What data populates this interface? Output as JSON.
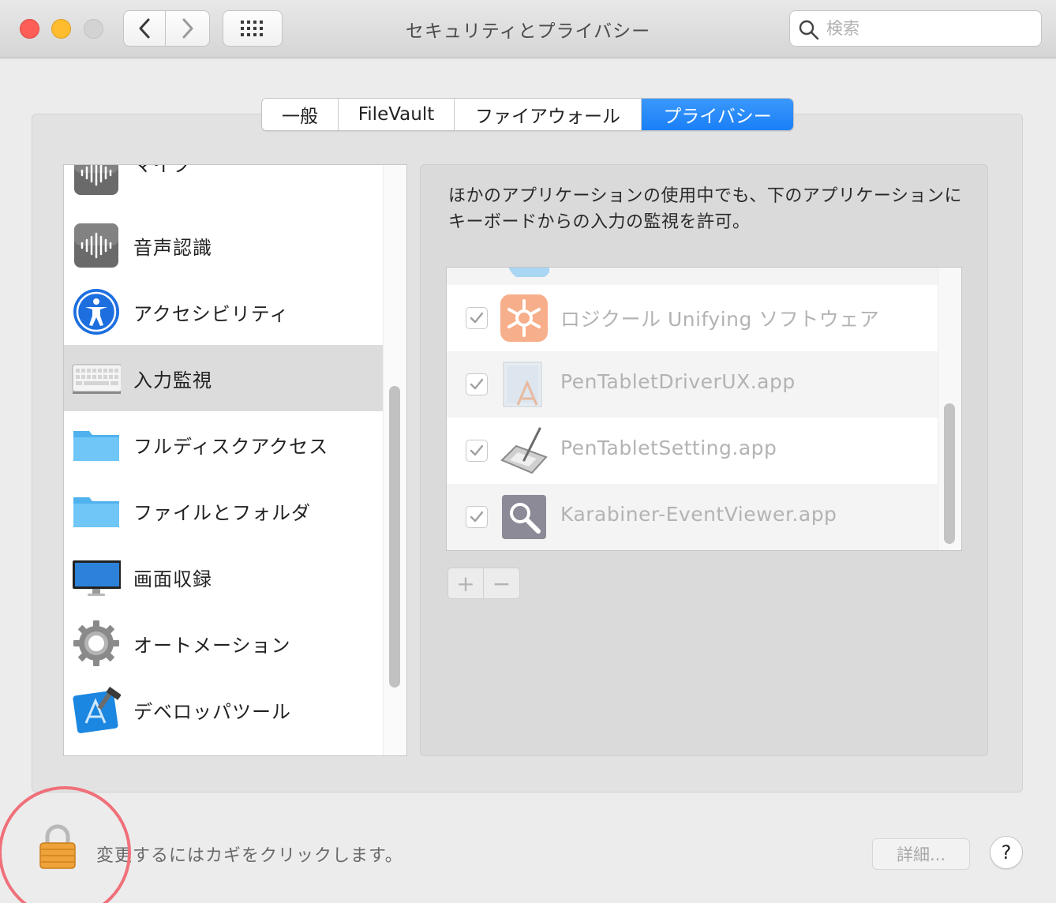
{
  "window": {
    "title": "セキュリティとプライバシー",
    "search_placeholder": "検索"
  },
  "tabs": [
    {
      "label": "一般"
    },
    {
      "label": "FileVault"
    },
    {
      "label": "ファイアウォール"
    },
    {
      "label": "プライバシー",
      "selected": true
    }
  ],
  "categories": [
    {
      "label": "マイク",
      "icon": "microphone-icon"
    },
    {
      "label": "音声認識",
      "icon": "speech-recognition-icon"
    },
    {
      "label": "アクセシビリティ",
      "icon": "accessibility-icon"
    },
    {
      "label": "入力監視",
      "icon": "keyboard-icon",
      "selected": true
    },
    {
      "label": "フルディスクアクセス",
      "icon": "folder-icon"
    },
    {
      "label": "ファイルとフォルダ",
      "icon": "folder-icon"
    },
    {
      "label": "画面収録",
      "icon": "display-icon"
    },
    {
      "label": "オートメーション",
      "icon": "gear-icon"
    },
    {
      "label": "デベロッパツール",
      "icon": "xcode-icon"
    }
  ],
  "detail": {
    "description": "ほかのアプリケーションの使用中でも、下のアプリケーションにキーボードからの入力の監視を許可。",
    "apps": [
      {
        "name": "ロジクール Unifying ソフトウェア",
        "checked": true,
        "icon": "logitech-unifying-icon"
      },
      {
        "name": "PenTabletDriverUX.app",
        "checked": true,
        "icon": "app-document-icon"
      },
      {
        "name": "PenTabletSetting.app",
        "checked": true,
        "icon": "pen-tablet-icon"
      },
      {
        "name": "Karabiner-EventViewer.app",
        "checked": true,
        "icon": "magnifier-app-icon"
      }
    ],
    "add_label": "+",
    "remove_label": "−"
  },
  "footer": {
    "lock_text": "変更するにはカギをクリックします。",
    "advanced_label": "詳細...",
    "help_label": "?"
  },
  "colors": {
    "accent": "#1a7ff7",
    "highlight_circle": "#f0707a"
  }
}
